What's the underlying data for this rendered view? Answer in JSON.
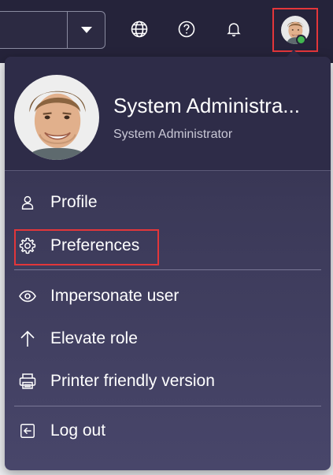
{
  "header": {
    "icons": {
      "scope_caret": "chevron-down-icon",
      "language": "globe-icon",
      "help": "help-icon",
      "notifications": "bell-icon",
      "user": "avatar"
    },
    "presence_color": "#42b650"
  },
  "user_menu": {
    "name": "System Administra...",
    "role": "System Administrator",
    "items": [
      {
        "label": "Profile",
        "icon": "user-icon"
      },
      {
        "label": "Preferences",
        "icon": "gear-icon",
        "highlighted": true
      },
      {
        "label": "Impersonate user",
        "icon": "eye-icon"
      },
      {
        "label": "Elevate role",
        "icon": "arrow-up-icon"
      },
      {
        "label": "Printer friendly version",
        "icon": "printer-icon"
      },
      {
        "label": "Log out",
        "icon": "logout-icon"
      }
    ]
  },
  "colors": {
    "topbar": "#25233a",
    "menu": "#2e2c48",
    "highlight": "#e3363a"
  }
}
